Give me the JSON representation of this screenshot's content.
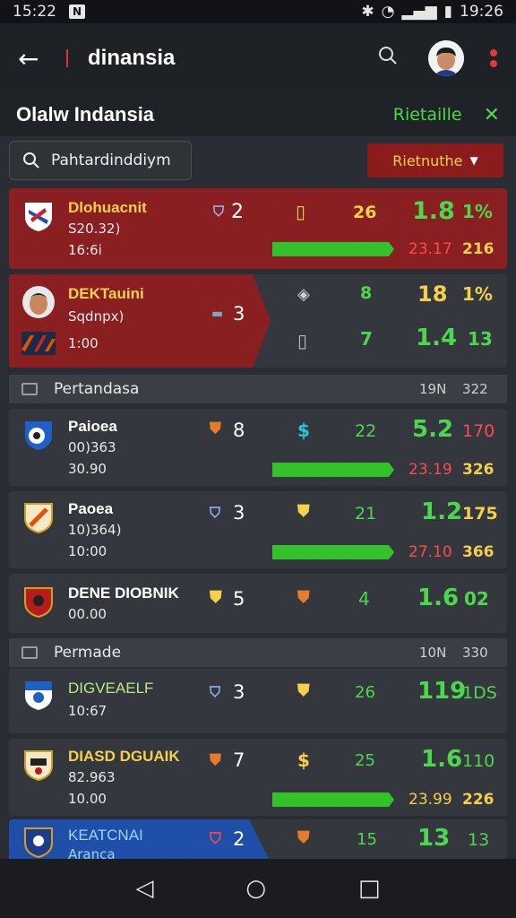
{
  "status": {
    "time_left": "15:22",
    "n_badge": "N",
    "time_right": "19:26"
  },
  "appbar": {
    "title": "dinansia"
  },
  "subheader": {
    "title": "Olalw Indansia",
    "action": "Rietaille",
    "close": "✕"
  },
  "search": {
    "value": "Pahtardinddiym"
  },
  "filter": {
    "label": "Rietnuthe"
  },
  "colors": {
    "accent_green": "#34c12b",
    "accent_red": "#8c1c1c",
    "yellow": "#f5d04a"
  },
  "rows": [
    {
      "name": "Dlohuacnit",
      "sub1": "S20.32)",
      "sub2": "16:6i",
      "c1": "2",
      "c3": "26",
      "c4": "1.8",
      "c5": "1%",
      "c6": "23.17",
      "c7": "216"
    },
    {
      "name": "DEKTauini",
      "sub1": "Sqdnpx)",
      "sub2": "1:00",
      "c1": "3",
      "c2": "8",
      "c3": "18",
      "c4": "1%",
      "c5": "7",
      "c6": "1.4",
      "c7": "13"
    },
    {
      "name": "Paioea",
      "sub1": "00)363",
      "sub2": "30.90",
      "c1": "8",
      "c3": "22",
      "c4": "5.2",
      "c5": "170",
      "c6": "23.19",
      "c7": "326"
    },
    {
      "name": "Paoea",
      "sub1": "10)364)",
      "sub2": "10:00",
      "c1": "3",
      "c3": "21",
      "c4": "1.2",
      "c5": "175",
      "c6": "27.10",
      "c7": "366"
    },
    {
      "name": "DENE DIOBNIK",
      "sub1": "00.00",
      "c1": "5",
      "c3": "4",
      "c4": "1.6",
      "c5": "02"
    },
    {
      "name": "DIGVEAELF",
      "sub1": "10:67",
      "c1": "3",
      "c3": "26",
      "c4": "119",
      "c5": "1DS"
    },
    {
      "name": "DIASD DGUAIK",
      "sub1": "82.963",
      "sub2": "10.00",
      "c1": "7",
      "c3": "25",
      "c4": "1.6",
      "c5": "110",
      "c6": "23.99",
      "c7": "226"
    },
    {
      "name": "KEATCNAI",
      "sub1": "Aranca",
      "c1": "2",
      "c3": "15",
      "c4": "13",
      "c5": "13"
    }
  ],
  "sections": [
    {
      "label": "Pertandasa",
      "v1": "19N",
      "v2": "322"
    },
    {
      "label": "Permade",
      "v1": "10N",
      "v2": "330"
    }
  ]
}
